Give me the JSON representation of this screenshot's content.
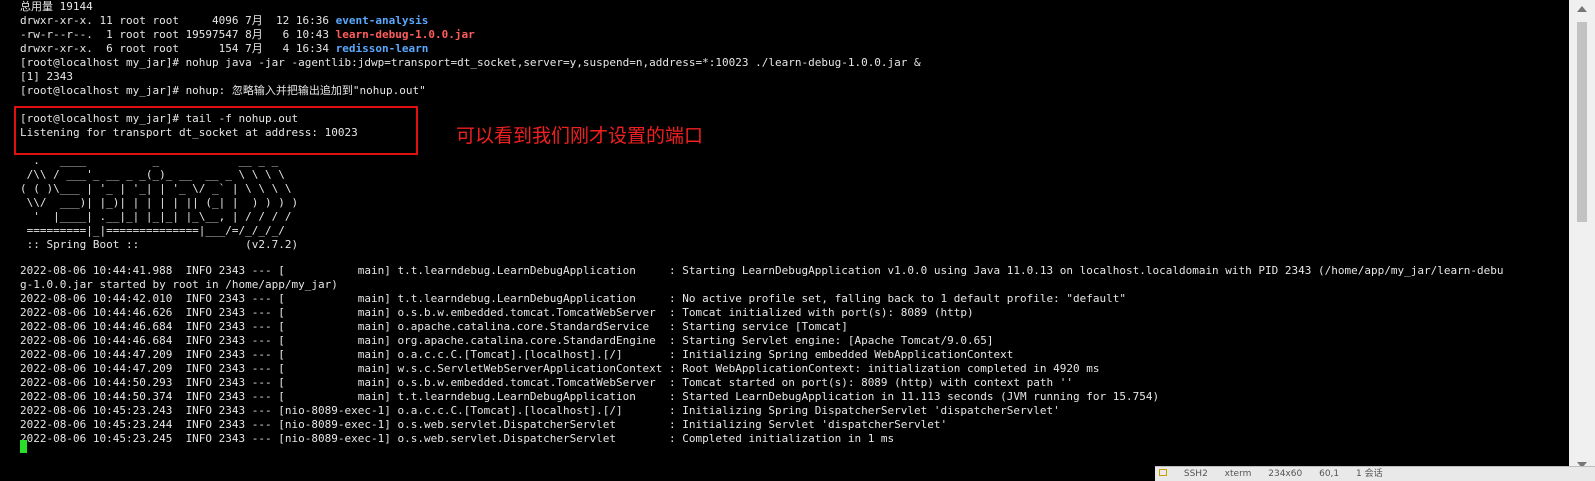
{
  "terminal": {
    "listing": {
      "total": "总用量 19144",
      "rows": [
        {
          "meta": "drwxr-xr-x. 11 root root     4096 7月  12 16:36 ",
          "name": "event-analysis",
          "kind": "dir"
        },
        {
          "meta": "-rw-r--r--.  1 root root 19597547 8月   6 10:43 ",
          "name": "learn-debug-1.0.0.jar",
          "kind": "jar"
        },
        {
          "meta": "drwxr-xr-x.  6 root root      154 7月   4 16:34 ",
          "name": "redisson-learn",
          "kind": "dir"
        }
      ]
    },
    "commands": {
      "nohup_cmd": "[root@localhost my_jar]# nohup java -jar -agentlib:jdwp=transport=dt_socket,server=y,suspend=n,address=*:10023 ./learn-debug-1.0.0.jar &",
      "job": "[1] 2343",
      "nohup_msg": "[root@localhost my_jar]# nohup: 忽略输入并把输出追加到\"nohup.out\"",
      "tail_cmd": "[root@localhost my_jar]# tail -f nohup.out",
      "listening": "Listening for transport dt_socket at address: 10023"
    },
    "banner": [
      "  .   ____          _            __ _ _",
      " /\\\\ / ___'_ __ _ _(_)_ __  __ _ \\ \\ \\ \\",
      "( ( )\\___ | '_ | '_| | '_ \\/ _` | \\ \\ \\ \\",
      " \\\\/  ___)| |_)| | | | | || (_| |  ) ) ) )",
      "  '  |____| .__|_| |_|_| |_\\__, | / / / /",
      " =========|_|==============|___/=/_/_/_/",
      " :: Spring Boot ::                (v2.7.2)"
    ],
    "logs": [
      "2022-08-06 10:44:41.988  INFO 2343 --- [           main] t.t.learndebug.LearnDebugApplication     : Starting LearnDebugApplication v1.0.0 using Java 11.0.13 on localhost.localdomain with PID 2343 (/home/app/my_jar/learn-debu",
      "g-1.0.0.jar started by root in /home/app/my_jar)",
      "2022-08-06 10:44:42.010  INFO 2343 --- [           main] t.t.learndebug.LearnDebugApplication     : No active profile set, falling back to 1 default profile: \"default\"",
      "2022-08-06 10:44:46.626  INFO 2343 --- [           main] o.s.b.w.embedded.tomcat.TomcatWebServer  : Tomcat initialized with port(s): 8089 (http)",
      "2022-08-06 10:44:46.684  INFO 2343 --- [           main] o.apache.catalina.core.StandardService   : Starting service [Tomcat]",
      "2022-08-06 10:44:46.684  INFO 2343 --- [           main] org.apache.catalina.core.StandardEngine  : Starting Servlet engine: [Apache Tomcat/9.0.65]",
      "2022-08-06 10:44:47.209  INFO 2343 --- [           main] o.a.c.c.C.[Tomcat].[localhost].[/]       : Initializing Spring embedded WebApplicationContext",
      "2022-08-06 10:44:47.209  INFO 2343 --- [           main] w.s.c.ServletWebServerApplicationContext : Root WebApplicationContext: initialization completed in 4920 ms",
      "2022-08-06 10:44:50.293  INFO 2343 --- [           main] o.s.b.w.embedded.tomcat.TomcatWebServer  : Tomcat started on port(s): 8089 (http) with context path ''",
      "2022-08-06 10:44:50.374  INFO 2343 --- [           main] t.t.learndebug.LearnDebugApplication     : Started LearnDebugApplication in 11.113 seconds (JVM running for 15.754)",
      "2022-08-06 10:45:23.243  INFO 2343 --- [nio-8089-exec-1] o.a.c.c.C.[Tomcat].[localhost].[/]       : Initializing Spring DispatcherServlet 'dispatcherServlet'",
      "2022-08-06 10:45:23.244  INFO 2343 --- [nio-8089-exec-1] o.s.web.servlet.DispatcherServlet        : Initializing Servlet 'dispatcherServlet'",
      "2022-08-06 10:45:23.245  INFO 2343 --- [nio-8089-exec-1] o.s.web.servlet.DispatcherServlet        : Completed initialization in 1 ms"
    ]
  },
  "annotation": {
    "text": "可以看到我们刚才设置的端口",
    "color": "#f21f1f"
  },
  "statusbar": {
    "items": [
      "SSH2",
      "xterm",
      "234x60",
      "60,1",
      "1 会话"
    ]
  },
  "colors": {
    "background": "#000000",
    "text": "#e6e6e6",
    "directory": "#5aa8ff",
    "jar": "#ff5c5c",
    "cursor": "#28e028",
    "highlight_border": "#e01010"
  }
}
